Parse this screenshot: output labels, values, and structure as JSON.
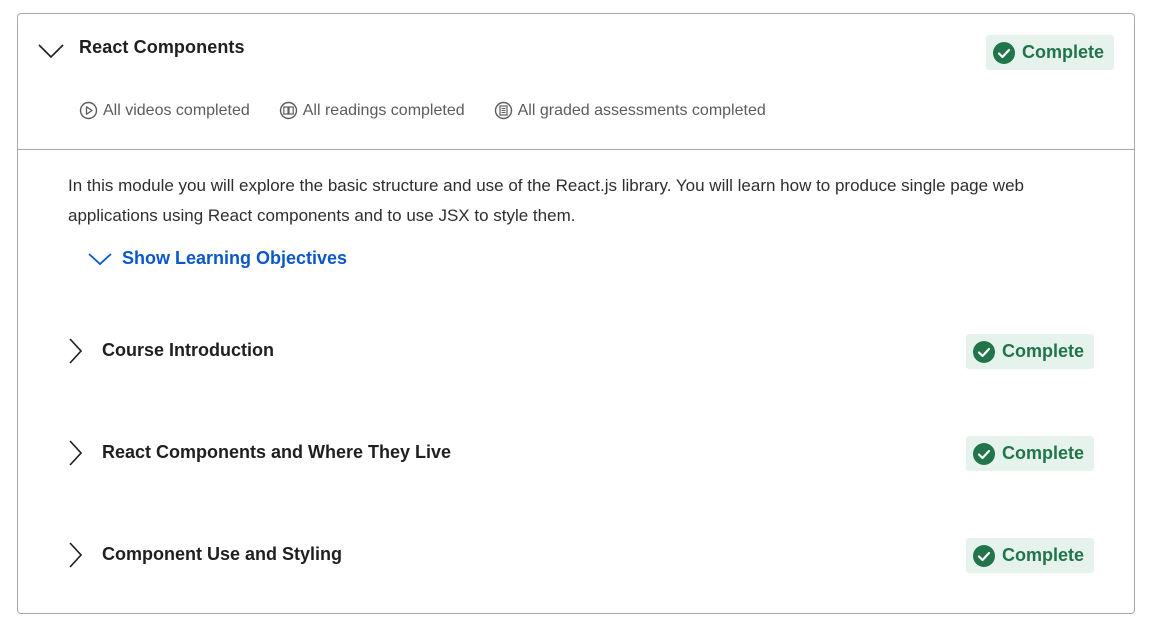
{
  "module": {
    "title": "React Components",
    "status": "Complete",
    "progress": [
      {
        "icon": "play-circle-icon",
        "label": "All videos completed"
      },
      {
        "icon": "book-icon",
        "label": "All readings completed"
      },
      {
        "icon": "assessment-icon",
        "label": "All graded assessments completed"
      }
    ],
    "description": "In this module you will explore the basic structure and use of the React.js library. You will learn how to produce single page web applications using React components and to use JSX to style them.",
    "objectives_toggle": "Show Learning Objectives",
    "lessons": [
      {
        "title": "Course Introduction",
        "status": "Complete"
      },
      {
        "title": "React Components and Where They Live",
        "status": "Complete"
      },
      {
        "title": "Component Use and Styling",
        "status": "Complete"
      }
    ]
  },
  "colors": {
    "success": "#22744a",
    "success_bg": "#e6f3ec",
    "link": "#0b58c9",
    "border": "#a8a8a8"
  }
}
